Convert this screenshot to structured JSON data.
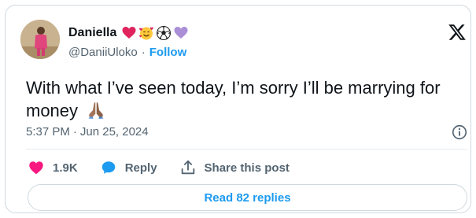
{
  "author": {
    "display_name": "Daniella",
    "emoji_icons": [
      "red-heart-icon",
      "smiling-face-with-hearts-icon",
      "soccer-ball-icon",
      "purple-heart-icon"
    ],
    "handle": "@DaniiUloko",
    "separator": "·",
    "follow_label": "Follow"
  },
  "tweet": {
    "text": "With what I’ve seen today, I’m sorry I’ll be marrying for money",
    "trailing_emoji_icon": "folded-hands-icon",
    "time": "5:37 PM",
    "meta_separator": "·",
    "date": "Jun 25, 2024"
  },
  "actions": {
    "likes_count": "1.9K",
    "reply_label": "Reply",
    "share_label": "Share this post"
  },
  "read_replies_label": "Read 82 replies",
  "colors": {
    "accent": "#1d9bf0",
    "like": "#f91880",
    "reply_icon": "#1d9bf0",
    "text": "#0f1419",
    "secondary": "#536471",
    "border": "#cfd9de"
  }
}
